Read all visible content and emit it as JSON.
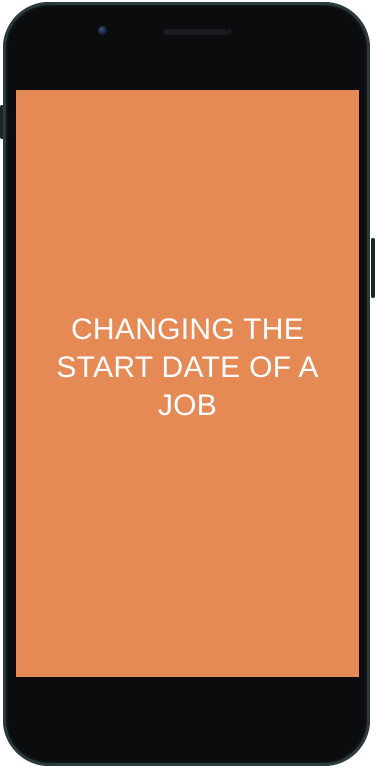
{
  "splash": {
    "title": "CHANGING THE START DATE OF A JOB",
    "background_color": "#e68a55",
    "text_color": "#ffffff"
  },
  "device": {
    "frame_color": "#0a0c0d",
    "bezel_accent": "#2b3a3d"
  }
}
